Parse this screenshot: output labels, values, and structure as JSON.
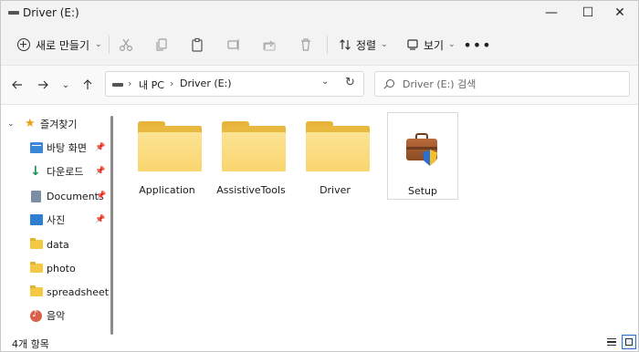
{
  "window": {
    "title": "Driver (E:)",
    "min_glyph": "—",
    "max_glyph": "☐",
    "close_glyph": "✕"
  },
  "commandbar": {
    "new_label": "새로 만들기",
    "sort_label": "정렬",
    "view_label": "보기",
    "more_glyph": "•••",
    "icons": [
      "cut-icon",
      "copy-icon",
      "paste-icon",
      "rename-icon",
      "share-icon",
      "delete-icon"
    ]
  },
  "address": {
    "crumbs": [
      "내 PC",
      "Driver (E:)"
    ],
    "search_placeholder": "Driver (E:) 검색"
  },
  "sidebar": {
    "items": [
      {
        "label": "즐겨찾기",
        "icon": "star-icon"
      },
      {
        "label": "바탕 화면",
        "icon": "desktop-icon",
        "pinned": true
      },
      {
        "label": "다운로드",
        "icon": "download-icon",
        "pinned": true
      },
      {
        "label": "Documents",
        "icon": "documents-icon",
        "pinned": true
      },
      {
        "label": "사진",
        "icon": "pictures-icon",
        "pinned": true
      },
      {
        "label": "data",
        "icon": "folder-icon"
      },
      {
        "label": "photo",
        "icon": "folder-icon"
      },
      {
        "label": "spreadsheet",
        "icon": "folder-icon"
      },
      {
        "label": "음악",
        "icon": "music-icon"
      }
    ]
  },
  "content": {
    "items": [
      {
        "name": "Application",
        "type": "folder"
      },
      {
        "name": "AssistiveTools",
        "type": "folder"
      },
      {
        "name": "Driver",
        "type": "folder"
      },
      {
        "name": "Setup",
        "type": "installer"
      }
    ]
  },
  "status": {
    "count_text": "4개 항목"
  },
  "colors": {
    "accent": "#2a6fd1",
    "folder": "#f9d56e"
  }
}
